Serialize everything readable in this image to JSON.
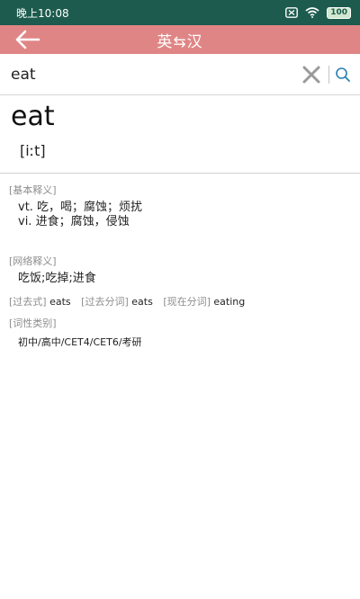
{
  "status_bar": {
    "time": "晚上10:08",
    "battery": "100"
  },
  "header": {
    "title": "英⇆汉"
  },
  "search": {
    "value": "eat"
  },
  "entry": {
    "word": "eat",
    "phonetic": "[iːt]",
    "basic_label": "[基本释义]",
    "basic_definitions": [
      "vt. 吃，喝；腐蚀；烦扰",
      "vi. 进食；腐蚀，侵蚀"
    ],
    "net_label": "[网络释义]",
    "net_definition": "吃饭;吃掉;进食",
    "forms": [
      {
        "label": "[过去式]",
        "value": "eats"
      },
      {
        "label": "[过去分词]",
        "value": "eats"
      },
      {
        "label": "[现在分词]",
        "value": "eating"
      }
    ],
    "category_label": "[词性类别]",
    "category_value": "初中/高中/CET4/CET6/考研"
  },
  "colors": {
    "status_bar": "#1d5b4e",
    "header": "#e08585",
    "search_icon": "#2a7fb0"
  }
}
